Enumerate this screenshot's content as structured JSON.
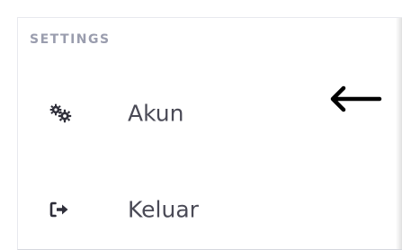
{
  "sidebar": {
    "section_title": "SETTINGS",
    "items": [
      {
        "label": "Akun",
        "icon": "cogs-icon"
      },
      {
        "label": "Keluar",
        "icon": "sign-out-icon"
      }
    ]
  },
  "annotation": {
    "icon": "left-arrow-icon"
  },
  "colors": {
    "section_title": "#9a9dae",
    "item_text": "#4a4a56",
    "icon": "#2f2f3a",
    "arrow": "#000000"
  }
}
